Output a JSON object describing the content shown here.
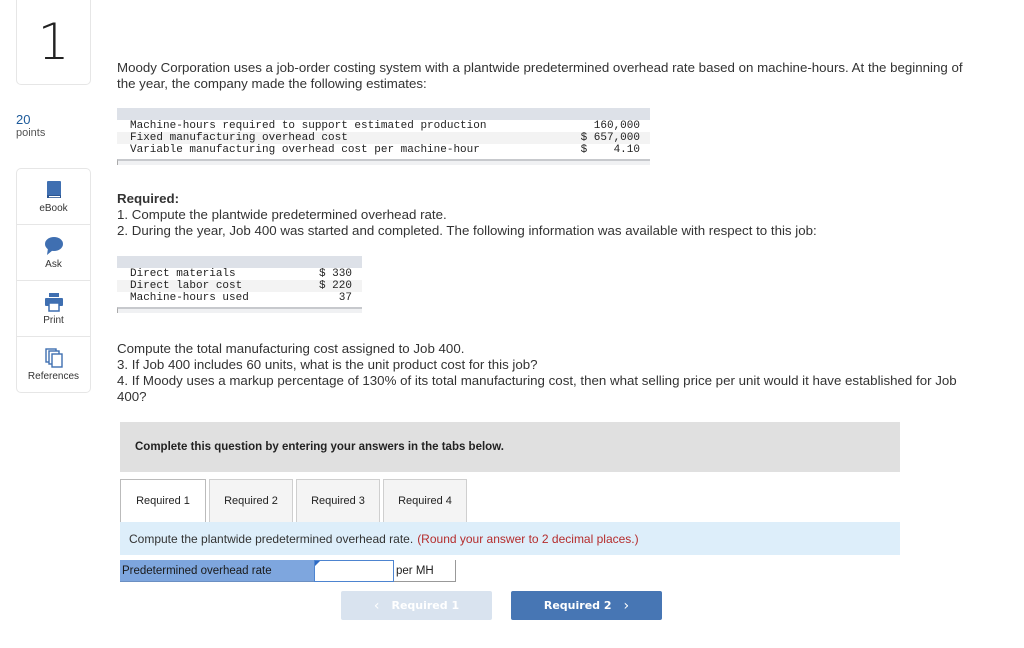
{
  "question": {
    "number": "1",
    "points_value": "20",
    "points_label": "points"
  },
  "tools": [
    {
      "label": "eBook",
      "icon": "book-icon"
    },
    {
      "label": "Ask",
      "icon": "speech-bubble-icon"
    },
    {
      "label": "Print",
      "icon": "printer-icon"
    },
    {
      "label": "References",
      "icon": "documents-icon"
    }
  ],
  "intro": "Moody Corporation uses a job-order costing system with a plantwide predetermined overhead rate based on machine-hours. At the beginning of the year, the company made the following estimates:",
  "estimates_table": [
    {
      "label": "Machine-hours required to support estimated production",
      "value": "  160,000"
    },
    {
      "label": "Fixed manufacturing overhead cost",
      "value": "$ 657,000"
    },
    {
      "label": "Variable manufacturing overhead cost per machine-hour",
      "value": "$    4.10"
    }
  ],
  "required": {
    "heading": "Required:",
    "item1": "1. Compute the plantwide predetermined overhead rate.",
    "item2": "2. During the year, Job 400 was started and completed. The following information was available with respect to this job:"
  },
  "job_table": [
    {
      "label": "Direct materials",
      "value": "$ 330"
    },
    {
      "label": "Direct labor cost",
      "value": "$ 220"
    },
    {
      "label": "Machine-hours used",
      "value": "   37"
    }
  ],
  "more": {
    "line1": "Compute the total manufacturing cost assigned to Job 400.",
    "line2": "3. If Job 400 includes 60 units, what is the unit product cost for this job?",
    "line3": "4. If Moody uses a markup percentage of 130% of its total manufacturing cost, then what selling price per unit would it have established for Job 400?"
  },
  "instruction": "Complete this question by entering your answers in the tabs below.",
  "tabs": [
    {
      "label": "Required 1",
      "active": true
    },
    {
      "label": "Required 2",
      "active": false
    },
    {
      "label": "Required 3",
      "active": false
    },
    {
      "label": "Required 4",
      "active": false
    }
  ],
  "task": {
    "text": "Compute the plantwide predetermined overhead rate.",
    "note": "(Round your answer to 2 decimal places.)"
  },
  "answer": {
    "label": "Predetermined overhead rate",
    "value": "",
    "unit": "per MH"
  },
  "nav": {
    "prev_label": "Required 1",
    "next_label": "Required 2",
    "prev_enabled": false
  },
  "colors": {
    "accent": "#4776b4",
    "points": "#1d5a9a",
    "note": "#b52c2c",
    "answer_label_bg": "#7ea6de",
    "task_bg": "#ddeefa"
  }
}
